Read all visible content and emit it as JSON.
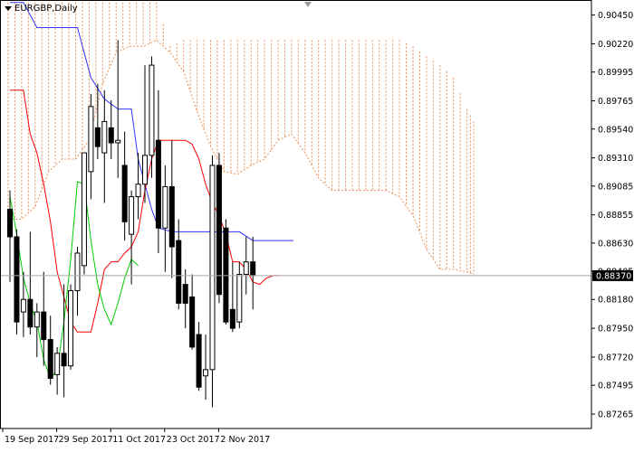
{
  "chart_data": {
    "type": "candlestick",
    "symbol_label": "EURGBP,Daily",
    "y_axis": {
      "min": 0.8715,
      "max": 0.9057,
      "tick_labels": [
        "0.90450",
        "0.90220",
        "0.89995",
        "0.89765",
        "0.89540",
        "0.89310",
        "0.89085",
        "0.88855",
        "0.88630",
        "0.88405",
        "0.88180",
        "0.87950",
        "0.87720",
        "0.87495",
        "0.87265"
      ]
    },
    "x_axis": {
      "tick_labels": [
        {
          "label": "19 Sep 2017",
          "index": 0
        },
        {
          "label": "29 Sep 2017",
          "index": 8
        },
        {
          "label": "11 Oct 2017",
          "index": 16
        },
        {
          "label": "23 Oct 2017",
          "index": 24
        },
        {
          "label": "2 Nov 2017",
          "index": 32
        }
      ]
    },
    "current_price": "0.88370",
    "current_value": 0.8837,
    "cloud_color": "#e8915a",
    "colors": {
      "tenkan": "#00cc00",
      "kijun": "#ff0000",
      "chikou_blue": "#3333ff",
      "price_line": "#a9a9a9",
      "candle": "#000000"
    },
    "candles": [
      {
        "o": 0.889,
        "h": 0.8905,
        "l": 0.8832,
        "c": 0.8868
      },
      {
        "o": 0.8868,
        "h": 0.8874,
        "l": 0.879,
        "c": 0.88
      },
      {
        "o": 0.8808,
        "h": 0.884,
        "l": 0.8788,
        "c": 0.8818
      },
      {
        "o": 0.8818,
        "h": 0.8872,
        "l": 0.879,
        "c": 0.8796
      },
      {
        "o": 0.8796,
        "h": 0.8815,
        "l": 0.8772,
        "c": 0.8808
      },
      {
        "o": 0.8808,
        "h": 0.884,
        "l": 0.8765,
        "c": 0.8786
      },
      {
        "o": 0.8786,
        "h": 0.8805,
        "l": 0.875,
        "c": 0.8755
      },
      {
        "o": 0.8758,
        "h": 0.878,
        "l": 0.8742,
        "c": 0.8775
      },
      {
        "o": 0.8775,
        "h": 0.883,
        "l": 0.874,
        "c": 0.8765
      },
      {
        "o": 0.8765,
        "h": 0.883,
        "l": 0.8762,
        "c": 0.8825
      },
      {
        "o": 0.8825,
        "h": 0.886,
        "l": 0.8805,
        "c": 0.8855
      },
      {
        "o": 0.8845,
        "h": 0.8935,
        "l": 0.8838,
        "c": 0.8935
      },
      {
        "o": 0.892,
        "h": 0.8982,
        "l": 0.8898,
        "c": 0.8972
      },
      {
        "o": 0.8955,
        "h": 0.899,
        "l": 0.893,
        "c": 0.894
      },
      {
        "o": 0.8935,
        "h": 0.8985,
        "l": 0.8895,
        "c": 0.896
      },
      {
        "o": 0.8955,
        "h": 0.8977,
        "l": 0.893,
        "c": 0.8943
      },
      {
        "o": 0.8943,
        "h": 0.9025,
        "l": 0.8915,
        "c": 0.8945
      },
      {
        "o": 0.8925,
        "h": 0.8952,
        "l": 0.8865,
        "c": 0.888
      },
      {
        "o": 0.887,
        "h": 0.8905,
        "l": 0.883,
        "c": 0.89
      },
      {
        "o": 0.89,
        "h": 0.8935,
        "l": 0.8882,
        "c": 0.891
      },
      {
        "o": 0.891,
        "h": 0.9005,
        "l": 0.8895,
        "c": 0.8933
      },
      {
        "o": 0.8933,
        "h": 0.9012,
        "l": 0.8915,
        "c": 0.9005
      },
      {
        "o": 0.8945,
        "h": 0.8985,
        "l": 0.8855,
        "c": 0.8875
      },
      {
        "o": 0.8875,
        "h": 0.8925,
        "l": 0.884,
        "c": 0.8908
      },
      {
        "o": 0.8908,
        "h": 0.8945,
        "l": 0.8835,
        "c": 0.886
      },
      {
        "o": 0.8865,
        "h": 0.8882,
        "l": 0.881,
        "c": 0.8815
      },
      {
        "o": 0.883,
        "h": 0.8842,
        "l": 0.8795,
        "c": 0.8815
      },
      {
        "o": 0.882,
        "h": 0.8838,
        "l": 0.8778,
        "c": 0.878
      },
      {
        "o": 0.879,
        "h": 0.88,
        "l": 0.8745,
        "c": 0.8748
      },
      {
        "o": 0.8757,
        "h": 0.879,
        "l": 0.8738,
        "c": 0.8762
      },
      {
        "o": 0.8762,
        "h": 0.8933,
        "l": 0.8732,
        "c": 0.8925
      },
      {
        "o": 0.8925,
        "h": 0.8935,
        "l": 0.8815,
        "c": 0.8822
      },
      {
        "o": 0.8875,
        "h": 0.8882,
        "l": 0.8798,
        "c": 0.88
      },
      {
        "o": 0.881,
        "h": 0.8848,
        "l": 0.8792,
        "c": 0.8795
      },
      {
        "o": 0.88,
        "h": 0.8848,
        "l": 0.8795,
        "c": 0.8838
      },
      {
        "o": 0.8838,
        "h": 0.8868,
        "l": 0.8822,
        "c": 0.8848
      },
      {
        "o": 0.8848,
        "h": 0.8868,
        "l": 0.881,
        "c": 0.8837
      }
    ]
  }
}
